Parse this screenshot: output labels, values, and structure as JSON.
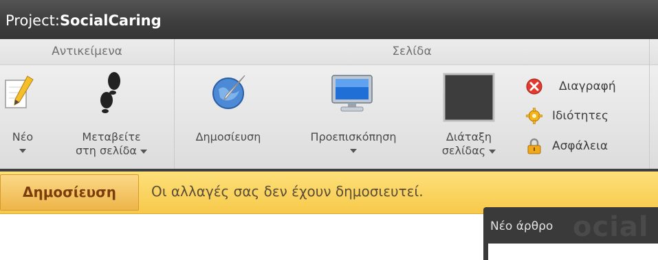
{
  "app": {
    "title_prefix": "Project:",
    "title_name": "SocialCaring"
  },
  "ribbon": {
    "groups": {
      "objects": "Αντικείμενα",
      "page": "Σελίδα"
    },
    "new": {
      "label": "Νέο"
    },
    "navigate": {
      "line1": "Μεταβείτε",
      "line2": "στη σελίδα"
    },
    "publish": {
      "label": "Δημοσίευση"
    },
    "preview": {
      "label": "Προεπισκόπηση"
    },
    "layout": {
      "line1": "Διάταξη",
      "line2": "σελίδας"
    },
    "delete": {
      "label": "Διαγραφή"
    },
    "properties": {
      "label": "Ιδιότητες"
    },
    "security": {
      "label": "Ασφάλεια"
    }
  },
  "notification": {
    "button": "Δημοσίευση",
    "message": "Οι αλλαγές σας δεν έχουν δημοσιευτεί."
  },
  "popup": {
    "title": "Νέο άρθρο",
    "ghost": "ocial"
  },
  "icons": {
    "new": "pencil-page-icon",
    "navigate": "footprints-icon",
    "publish": "globe-quill-icon",
    "preview": "monitor-icon",
    "layout": "layout-square-icon",
    "delete": "red-x-icon",
    "properties": "gear-icon",
    "security": "padlock-icon"
  }
}
